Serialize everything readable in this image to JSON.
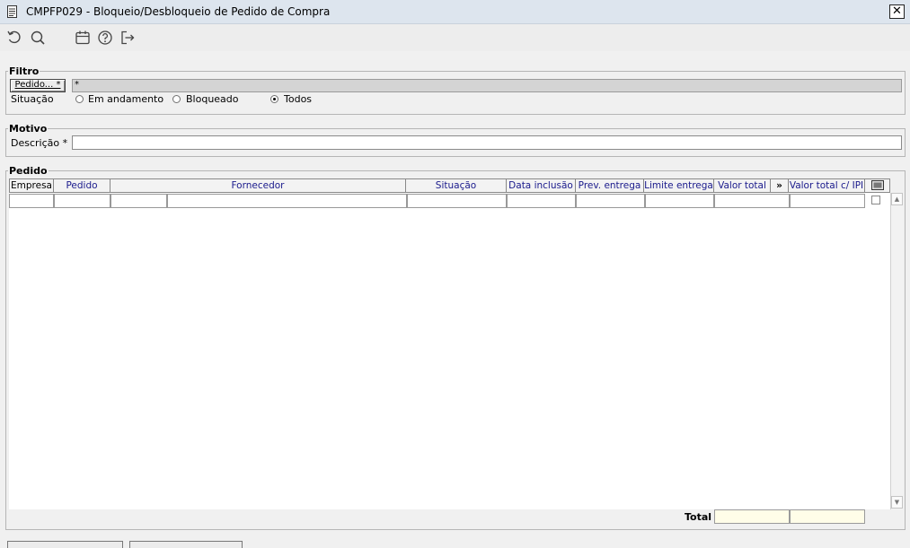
{
  "window": {
    "title": "CMPFP029 - Bloqueio/Desbloqueio de Pedido de Compra",
    "close_label": "✕"
  },
  "toolbar": {
    "icons": [
      "refresh-icon",
      "search-icon",
      "calendar-icon",
      "help-icon",
      "exit-icon"
    ]
  },
  "filtro": {
    "legend": "Filtro",
    "pedido_button": "Pedido... *",
    "pedido_value": "*",
    "situacao_label": "Situação",
    "options": [
      {
        "label": "Em andamento",
        "checked": false
      },
      {
        "label": "Bloqueado",
        "checked": false
      },
      {
        "label": "Todos",
        "checked": true
      }
    ]
  },
  "motivo": {
    "legend": "Motivo",
    "descricao_label": "Descrição *",
    "descricao_value": ""
  },
  "pedido": {
    "legend": "Pedido",
    "columns": [
      "Empresa",
      "Pedido",
      "Fornecedor",
      "Situação",
      "Data inclusão",
      "Prev. entrega",
      "Limite entrega",
      "Valor total",
      "»",
      "Valor total c/ IPI"
    ],
    "total_label": "Total",
    "total_values": [
      "",
      ""
    ]
  }
}
